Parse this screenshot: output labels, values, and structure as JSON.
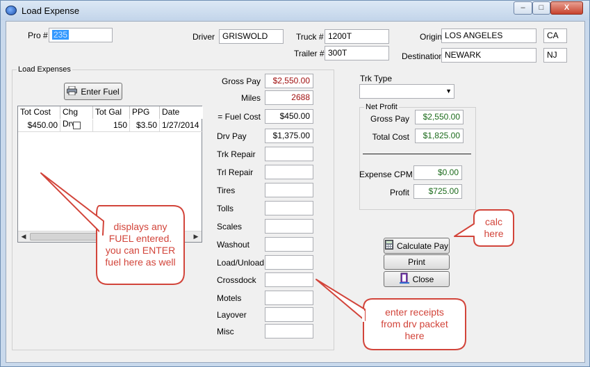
{
  "window": {
    "title": "Load Expense",
    "minimize": "–",
    "maximize": "□",
    "close": "X"
  },
  "header": {
    "pro_label": "Pro #",
    "pro_value": "235",
    "driver_label": "Driver",
    "driver_value": "GRISWOLD",
    "truck_label": "Truck #",
    "truck_value": "1200T",
    "trailer_label": "Trailer #",
    "trailer_value": "300T",
    "origin_label": "Origin",
    "origin_city": "LOS ANGELES",
    "origin_state": "CA",
    "destination_label": "Destination",
    "destination_city": "NEWARK",
    "destination_state": "NJ"
  },
  "load_expenses": {
    "title": "Load Expenses",
    "enter_fuel_label": "Enter Fuel",
    "columns": [
      "Tot Cost",
      "Chg Drv",
      "Tot Gal",
      "PPG",
      "Date"
    ],
    "rows": [
      {
        "tot_cost": "$450.00",
        "chg_drv": false,
        "tot_gal": "150",
        "ppg": "$3.50",
        "date": "1/27/2014"
      }
    ],
    "scroll_left": "◀",
    "scroll_right": "▶"
  },
  "expenses": [
    {
      "label": "Gross Pay",
      "value": "$2,550.00"
    },
    {
      "label": "Miles",
      "value": "2688"
    },
    {
      "label": "=  Fuel Cost",
      "value": "$450.00"
    },
    {
      "label": "Drv Pay",
      "value": "$1,375.00"
    },
    {
      "label": "Trk Repair",
      "value": ""
    },
    {
      "label": "Trl Repair",
      "value": ""
    },
    {
      "label": "Tires",
      "value": ""
    },
    {
      "label": "Tolls",
      "value": ""
    },
    {
      "label": "Scales",
      "value": ""
    },
    {
      "label": "Washout",
      "value": ""
    },
    {
      "label": "Load/Unload",
      "value": ""
    },
    {
      "label": "Crossdock",
      "value": ""
    },
    {
      "label": "Motels",
      "value": ""
    },
    {
      "label": "Layover",
      "value": ""
    },
    {
      "label": "Misc",
      "value": ""
    }
  ],
  "trk_type": {
    "label": "Trk Type",
    "value": "",
    "arrow": "▼"
  },
  "net_profit": {
    "title": "Net Profit",
    "gross_pay_label": "Gross Pay",
    "gross_pay": "$2,550.00",
    "total_cost_label": "Total Cost",
    "total_cost": "$1,825.00",
    "expense_cpm_label": "Expense CPM",
    "expense_cpm": "$0.00",
    "profit_label": "Profit",
    "profit": "$725.00"
  },
  "actions": {
    "calculate": "Calculate Pay",
    "print": "Print",
    "close": "Close"
  },
  "annotations": {
    "fuel": [
      "displays any",
      "FUEL entered.",
      "you can ENTER",
      "fuel here as well"
    ],
    "calc": [
      "calc",
      "here"
    ],
    "receipts": [
      "enter receipts",
      "from drv packet",
      "here"
    ]
  },
  "colors": {
    "callout_stroke": "#d2443a",
    "callout_text": "#d2443a",
    "pay_value": "#a01010",
    "profit_value": "#1a6a1a"
  }
}
